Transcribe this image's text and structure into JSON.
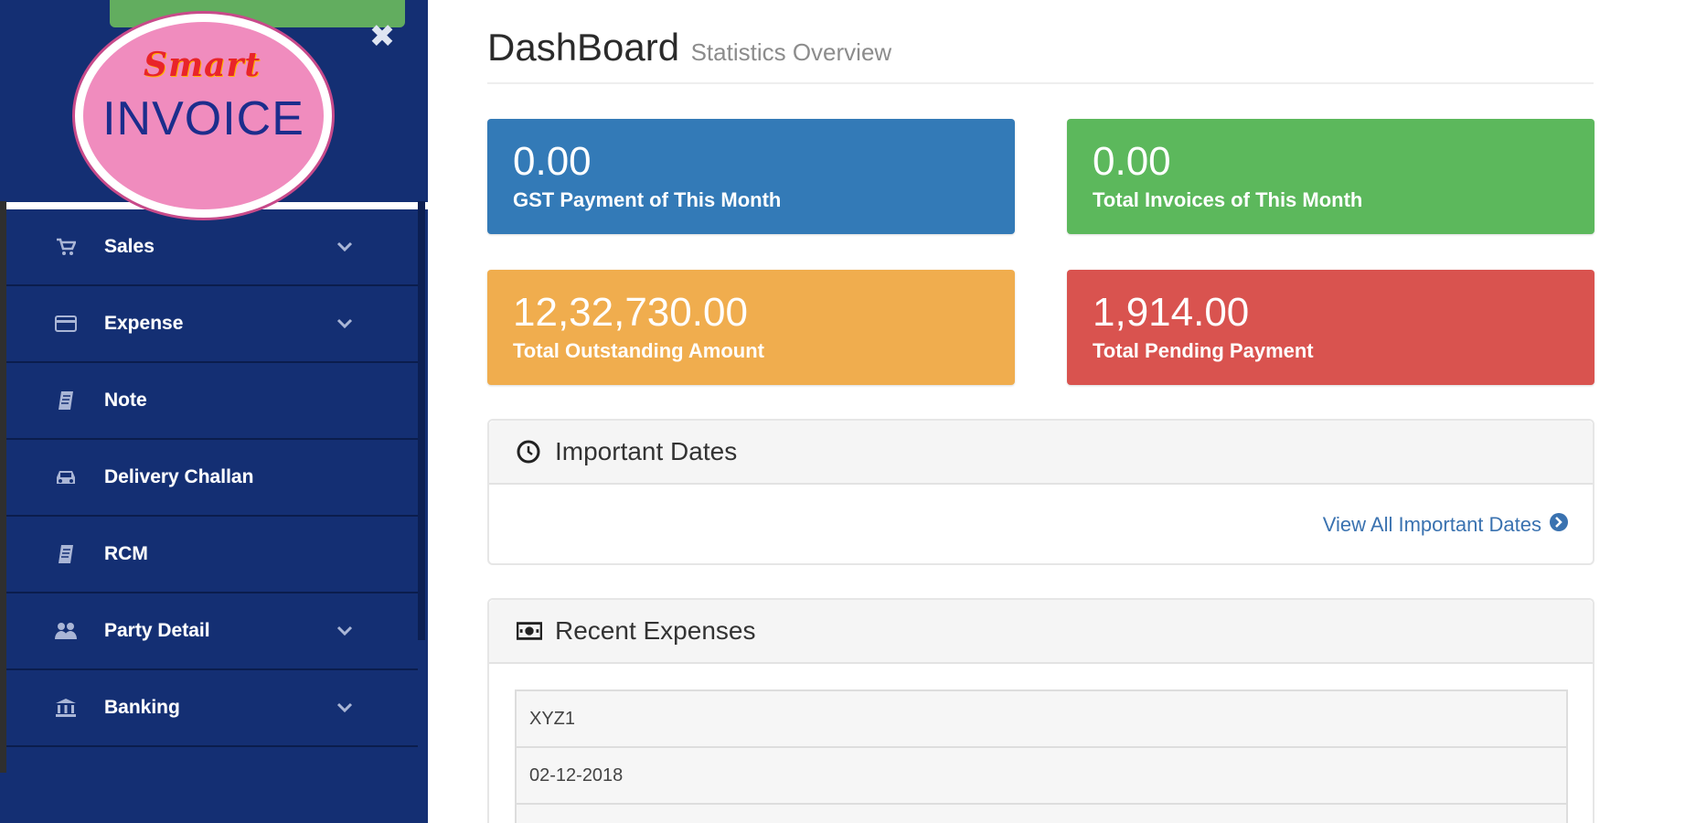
{
  "brand": {
    "logo_top_text": "Smart",
    "logo_main_text": "INVOICE"
  },
  "sidebar": {
    "close_glyph": "✖",
    "items": [
      {
        "label": "Sales",
        "icon": "cart-icon",
        "has_submenu": true
      },
      {
        "label": "Expense",
        "icon": "credit-card-icon",
        "has_submenu": true
      },
      {
        "label": "Note",
        "icon": "note-icon",
        "has_submenu": false
      },
      {
        "label": "Delivery Challan",
        "icon": "car-icon",
        "has_submenu": false
      },
      {
        "label": "RCM",
        "icon": "note-icon",
        "has_submenu": false
      },
      {
        "label": "Party Detail",
        "icon": "users-icon",
        "has_submenu": true
      },
      {
        "label": "Banking",
        "icon": "bank-icon",
        "has_submenu": true
      }
    ]
  },
  "header": {
    "title": "DashBoard",
    "subtitle": "Statistics Overview"
  },
  "stats": [
    {
      "value": "0.00",
      "label": "GST Payment of This Month",
      "color": "#337ab7"
    },
    {
      "value": "0.00",
      "label": "Total Invoices of This Month",
      "color": "#5cb85c"
    },
    {
      "value": "12,32,730.00",
      "label": "Total Outstanding Amount",
      "color": "#f0ad4e"
    },
    {
      "value": "1,914.00",
      "label": "Total Pending Payment",
      "color": "#d9534f"
    }
  ],
  "important_dates": {
    "title": "Important Dates",
    "view_all": "View All Important Dates"
  },
  "recent_expenses": {
    "title": "Recent Expenses",
    "rows": [
      "XYZ1",
      "02-12-2018"
    ]
  },
  "colors": {
    "sidebar_bg": "#142f73",
    "logo_bg": "#f08cbe",
    "link": "#3a72b0"
  }
}
